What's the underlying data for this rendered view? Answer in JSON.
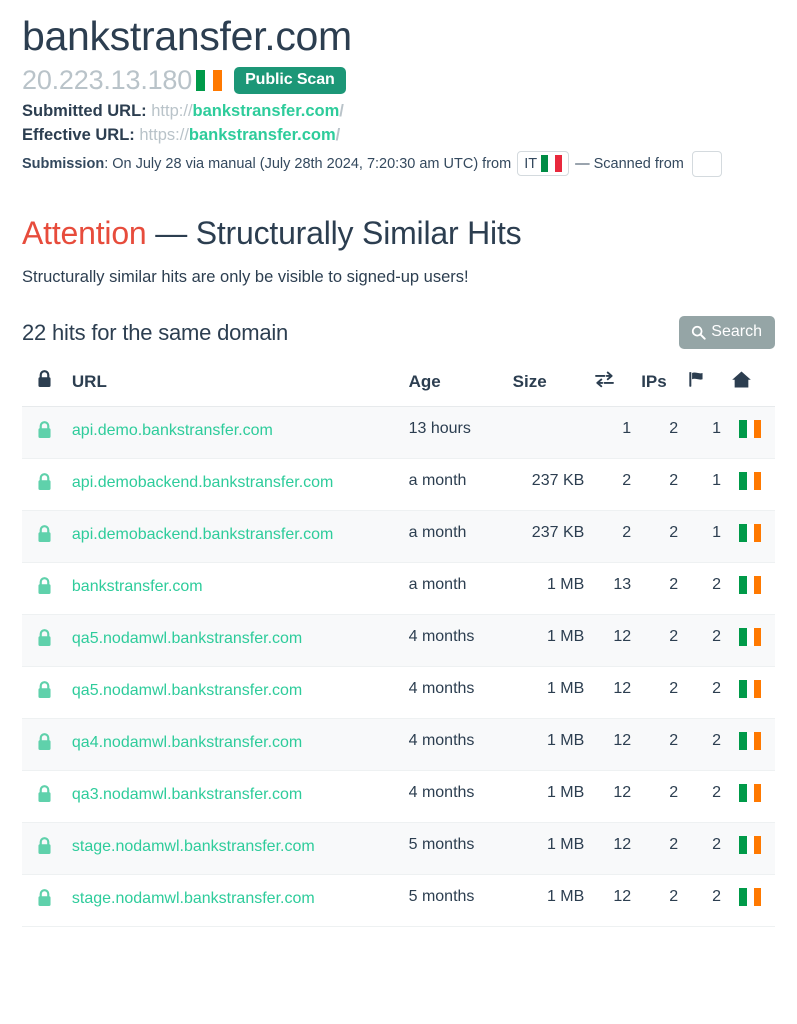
{
  "header": {
    "domain_title": "bankstransfer.com",
    "ip_address": "20.223.13.180",
    "country_flag": "ireland-flag",
    "scan_badge": "Public Scan",
    "submitted_url": {
      "label": "Submitted URL:",
      "scheme": "http://",
      "host": "bankstransfer.com",
      "path": "/"
    },
    "effective_url": {
      "label": "Effective URL:",
      "scheme": "https://",
      "host": "bankstransfer.com",
      "path": "/"
    },
    "submission": {
      "label": "Submission",
      "text_before": ": On July 28 via manual (July 28th 2024, 7:20:30 am UTC) from",
      "country_code": "IT",
      "country_flag": "italy-flag",
      "text_after": "— Scanned from"
    }
  },
  "attention": {
    "highlight": "Attention",
    "rest": "— Structurally Similar Hits",
    "note": "Structurally similar hits are only be visible to signed-up users!"
  },
  "hits": {
    "count_title": "22 hits for the same domain",
    "search_label": "Search",
    "columns": {
      "lock": "lock-icon",
      "url": "URL",
      "age": "Age",
      "size": "Size",
      "transfers": "exchange-arrows-icon",
      "ips": "IPs",
      "flag": "flag-icon",
      "home": "home-icon"
    },
    "rows": [
      {
        "url": "api.demo.bankstransfer.com",
        "age": "13 hours",
        "age_color": "red",
        "size": "",
        "transfers": "1",
        "transfers_color": "green",
        "ips": "2",
        "ips_color": "red",
        "flags": "1",
        "flags_color": "red",
        "country_flag": "ireland-flag"
      },
      {
        "url": "api.demobackend.bankstransfer.com",
        "age": "a month",
        "age_color": "dark",
        "size": "237 KB",
        "transfers": "2",
        "transfers_color": "green",
        "ips": "2",
        "ips_color": "dark",
        "flags": "1",
        "flags_color": "dark",
        "country_flag": "ireland-flag"
      },
      {
        "url": "api.demobackend.bankstransfer.com",
        "age": "a month",
        "age_color": "dark",
        "size": "237 KB",
        "transfers": "2",
        "transfers_color": "green",
        "ips": "2",
        "ips_color": "dark",
        "flags": "1",
        "flags_color": "dark",
        "country_flag": "ireland-flag"
      },
      {
        "url": "bankstransfer.com",
        "age": "a month",
        "age_color": "dark",
        "size": "1 MB",
        "transfers": "13",
        "transfers_color": "green",
        "ips": "2",
        "ips_color": "dark",
        "flags": "2",
        "flags_color": "dark",
        "country_flag": "ireland-flag"
      },
      {
        "url": "qa5.nodamwl.bankstransfer.com",
        "age": "4 months",
        "age_color": "dark",
        "size": "1 MB",
        "transfers": "12",
        "transfers_color": "green",
        "ips": "2",
        "ips_color": "dark",
        "flags": "2",
        "flags_color": "dark",
        "country_flag": "ireland-flag"
      },
      {
        "url": "qa5.nodamwl.bankstransfer.com",
        "age": "4 months",
        "age_color": "dark",
        "size": "1 MB",
        "transfers": "12",
        "transfers_color": "green",
        "ips": "2",
        "ips_color": "dark",
        "flags": "2",
        "flags_color": "dark",
        "country_flag": "ireland-flag"
      },
      {
        "url": "qa4.nodamwl.bankstransfer.com",
        "age": "4 months",
        "age_color": "dark",
        "size": "1 MB",
        "transfers": "12",
        "transfers_color": "green",
        "ips": "2",
        "ips_color": "dark",
        "flags": "2",
        "flags_color": "dark",
        "country_flag": "ireland-flag"
      },
      {
        "url": "qa3.nodamwl.bankstransfer.com",
        "age": "4 months",
        "age_color": "dark",
        "size": "1 MB",
        "transfers": "12",
        "transfers_color": "green",
        "ips": "2",
        "ips_color": "dark",
        "flags": "2",
        "flags_color": "dark",
        "country_flag": "ireland-flag"
      },
      {
        "url": "stage.nodamwl.bankstransfer.com",
        "age": "5 months",
        "age_color": "dark",
        "size": "1 MB",
        "transfers": "12",
        "transfers_color": "green",
        "ips": "2",
        "ips_color": "dark",
        "flags": "2",
        "flags_color": "dark",
        "country_flag": "ireland-flag"
      },
      {
        "url": "stage.nodamwl.bankstransfer.com",
        "age": "5 months",
        "age_color": "dark",
        "size": "1 MB",
        "transfers": "12",
        "transfers_color": "green",
        "ips": "2",
        "ips_color": "dark",
        "flags": "2",
        "flags_color": "dark",
        "country_flag": "ireland-flag"
      }
    ]
  },
  "colors": {
    "brand_green": "#2ecc9b",
    "badge_green": "#1c9777",
    "alert_red": "#e74c3c",
    "value_red": "#e8604c",
    "dark_navy": "#2c3e50",
    "muted_gray": "#b9c3c9",
    "search_gray": "#95a5a6",
    "flag_green": "#009a49",
    "flag_orange": "#ff7900"
  }
}
